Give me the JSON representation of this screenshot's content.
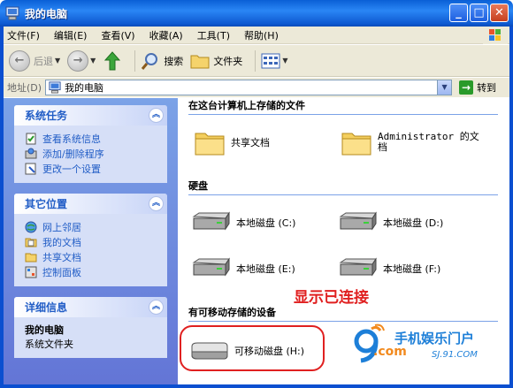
{
  "window": {
    "title": "我的电脑"
  },
  "menu": [
    "文件(F)",
    "编辑(E)",
    "查看(V)",
    "收藏(A)",
    "工具(T)",
    "帮助(H)"
  ],
  "toolbar": {
    "back": "后退",
    "search": "搜索",
    "folders": "文件夹"
  },
  "address": {
    "label": "地址(D)",
    "value": "我的电脑",
    "go": "转到"
  },
  "left": {
    "system_tasks": {
      "title": "系统任务",
      "items": [
        "查看系统信息",
        "添加/删除程序",
        "更改一个设置"
      ]
    },
    "other_places": {
      "title": "其它位置",
      "items": [
        "网上邻居",
        "我的文档",
        "共享文档",
        "控制面板"
      ]
    },
    "details": {
      "title": "详细信息",
      "name": "我的电脑",
      "desc": "系统文件夹"
    }
  },
  "right": {
    "sec_files": "在这台计算机上存储的文件",
    "shared_docs": "共享文档",
    "admin_docs": "Administrator 的文档",
    "sec_hdd": "硬盘",
    "drive_c": "本地磁盘 (C:)",
    "drive_d": "本地磁盘 (D:)",
    "drive_e": "本地磁盘 (E:)",
    "drive_f": "本地磁盘 (F:)",
    "sec_removable": "有可移动存储的设备",
    "removable": "可移动磁盘 (H:)"
  },
  "annotation": "显示已连接",
  "watermark": {
    "line1": "手机娱乐门户",
    "line2": "SJ.91.COM",
    "logo": ".com"
  }
}
